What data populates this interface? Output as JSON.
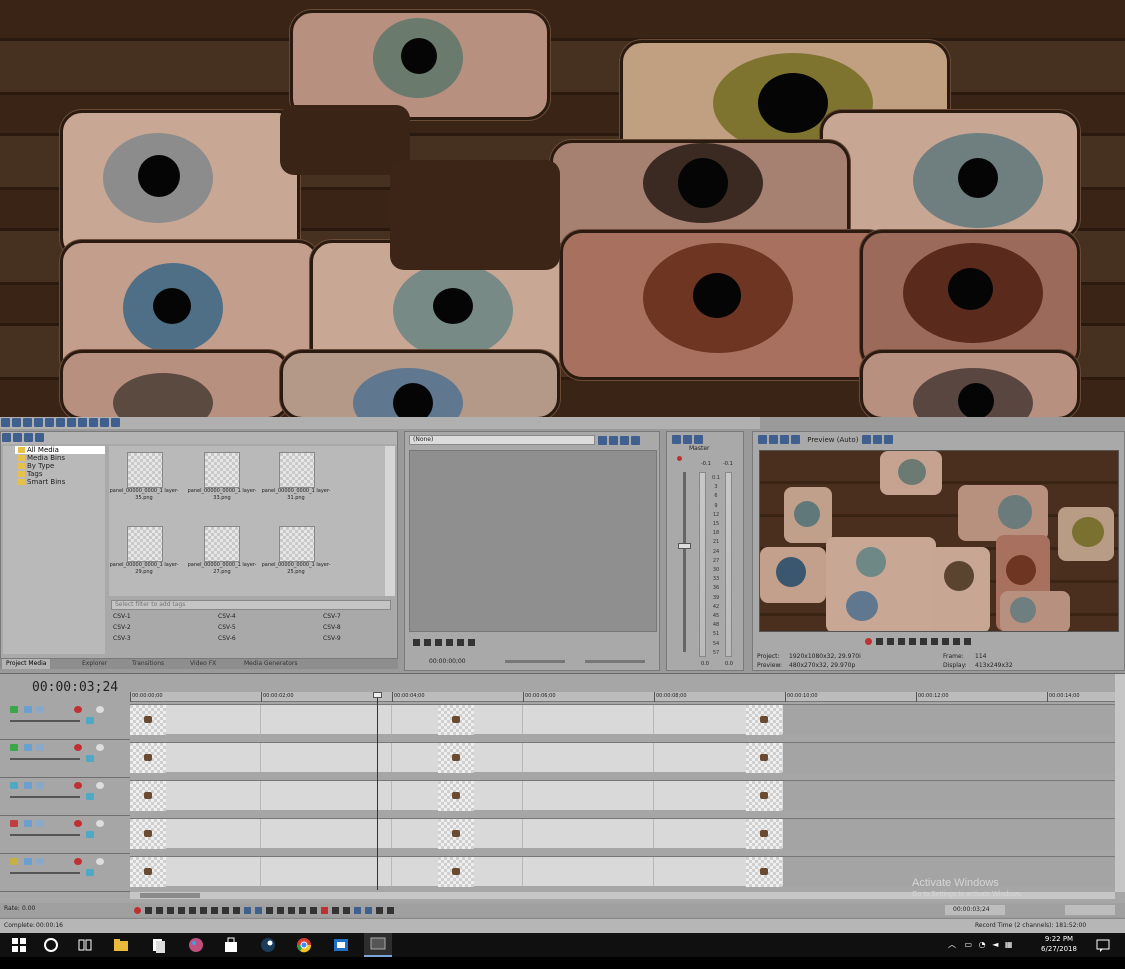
{
  "clip_bins": {
    "bins": [
      "All Media",
      "Media Bins",
      "By Type",
      "Tags",
      "Smart Bins"
    ],
    "filter_placeholder": "Select filter to add tags"
  },
  "clip_files": [
    {
      "name": "panel_00000_0000_1 layer-35.png"
    },
    {
      "name": "panel_00000_0000_1 layer-33.png"
    },
    {
      "name": "panel_00000_0000_1 layer-31.png"
    },
    {
      "name": "panel_00000_0000_1 layer-29.png"
    },
    {
      "name": "panel_00000_0000_1 layer-27.png"
    },
    {
      "name": "panel_00000_0000_1 layer-25.png"
    }
  ],
  "tags": [
    "CSV-1",
    "CSV-4",
    "CSV-7",
    "CSV-2",
    "CSV-5",
    "CSV-8",
    "CSV-3",
    "CSV-6",
    "CSV-9"
  ],
  "tabs": [
    "Project Media",
    "Explorer",
    "Transitions",
    "Video FX",
    "Media Generators"
  ],
  "trimmer": {
    "dropdown": "(None)",
    "time": "00:00:00;00"
  },
  "mixer": {
    "title": "Master",
    "scale": [
      "0.1",
      "3",
      "6",
      "9",
      "12",
      "15",
      "18",
      "21",
      "24",
      "27",
      "30",
      "33",
      "36",
      "39",
      "42",
      "45",
      "48",
      "51",
      "54",
      "57"
    ],
    "left_val": "0.0",
    "right_val": "0.0",
    "top_left": "-0.1",
    "top_right": "-0.1"
  },
  "preview": {
    "mode": "Preview (Auto)",
    "project_label": "Project:",
    "project_val": "1920x1080x32, 29.970i",
    "preview_label": "Preview:",
    "preview_val": "480x270x32, 29.970p",
    "frame_label": "Frame:",
    "frame_val": "114",
    "display_label": "Display:",
    "display_val": "413x249x32"
  },
  "timeline": {
    "time": "00:00:03;24",
    "ruler": [
      "00:00:00;00",
      "00:00:02;00",
      "00:00:04;00",
      "00:00:06;00",
      "00:00:08;00",
      "00:00:10;00",
      "00:00:12;00",
      "00:00:14;00"
    ],
    "rate_label": "Rate:",
    "rate_val": "0.00",
    "complete_label": "Complete:",
    "complete_val": "00:00:16",
    "end_time": "00:00:03;24",
    "record_time": "Record Time (2 channels): 181:52:00"
  },
  "watermark": {
    "line1": "Activate Windows",
    "line2": "Go to Settings to activate Windows."
  },
  "taskbar": {
    "time": "9:22 PM",
    "date": "6/27/2018"
  },
  "colors": {
    "app_bg": "#9a9a9a",
    "track_bg": "#d9d9d9",
    "taskbar": "#101010",
    "accent_blue": "#3f5f8f"
  },
  "icons": [
    "windows-icon",
    "cortana-icon",
    "task-view-icon",
    "file-explorer-icon",
    "solitaire-icon",
    "paint-icon",
    "store-icon",
    "steam-icon",
    "chrome-icon",
    "outlook-icon",
    "vegas-icon"
  ]
}
